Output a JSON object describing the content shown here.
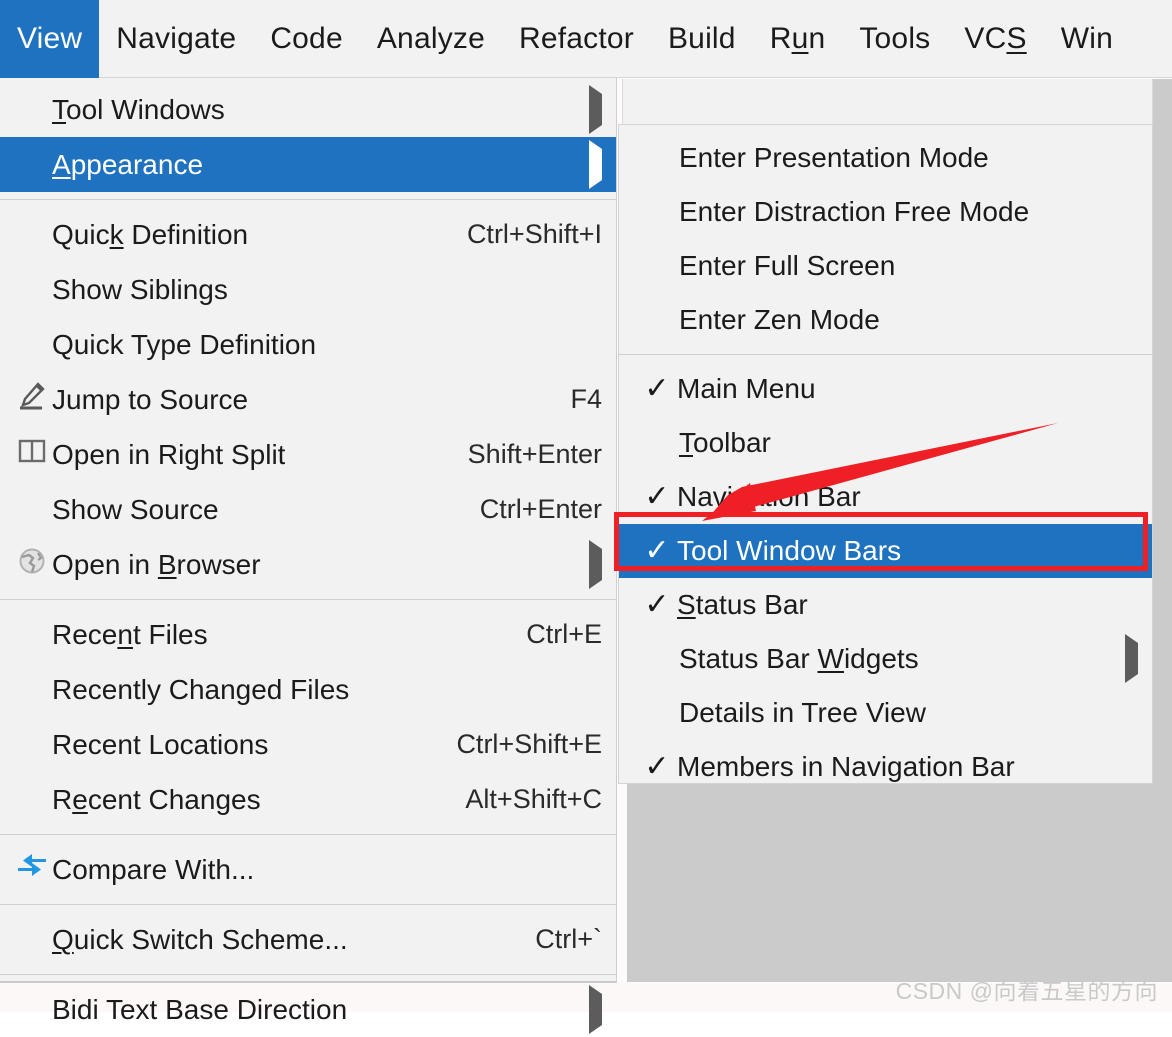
{
  "menubar": {
    "items": [
      {
        "label": "View",
        "mnemonic": "V",
        "active": true
      },
      {
        "label": "Navigate",
        "mnemonic": "N",
        "active": false
      },
      {
        "label": "Code",
        "mnemonic": "C",
        "active": false
      },
      {
        "label": "Analyze",
        "mnemonic": "A",
        "active": false
      },
      {
        "label": "Refactor",
        "mnemonic": "R",
        "active": false
      },
      {
        "label": "Build",
        "mnemonic": "B",
        "active": false
      },
      {
        "label": "Run",
        "mnemonic": "u",
        "active": false
      },
      {
        "label": "Tools",
        "mnemonic": "T",
        "active": false
      },
      {
        "label": "VCS",
        "mnemonic": "S",
        "active": false
      },
      {
        "label": "Win",
        "mnemonic": "W",
        "active": false
      }
    ]
  },
  "view_menu": {
    "items": [
      {
        "label": "Tool Windows",
        "mnemonic_pre": "T",
        "accel": "",
        "icon": "",
        "submenu": true,
        "selected": false,
        "checked": false
      },
      {
        "label": "Appearance",
        "mnemonic_pre": "A",
        "accel": "",
        "icon": "",
        "submenu": true,
        "selected": true,
        "checked": false
      },
      {
        "separator": true
      },
      {
        "label": "Quick Definition",
        "mnemonic_mid": "k",
        "accel": "Ctrl+Shift+I",
        "icon": "",
        "submenu": false,
        "selected": false,
        "checked": false
      },
      {
        "label": "Show Siblings",
        "accel": "",
        "icon": "",
        "submenu": false,
        "selected": false,
        "checked": false
      },
      {
        "label": "Quick Type Definition",
        "accel": "",
        "icon": "",
        "submenu": false,
        "selected": false,
        "checked": false
      },
      {
        "label": "Jump to Source",
        "accel": "F4",
        "icon": "pencil-icon",
        "submenu": false,
        "selected": false,
        "checked": false
      },
      {
        "label": "Open in Right Split",
        "accel": "Shift+Enter",
        "icon": "split-pane-icon",
        "submenu": false,
        "selected": false,
        "checked": false
      },
      {
        "label": "Show Source",
        "accel": "Ctrl+Enter",
        "icon": "",
        "submenu": false,
        "selected": false,
        "checked": false
      },
      {
        "label": "Open in Browser",
        "mnemonic_mid": "B",
        "accel": "",
        "icon": "globe-icon",
        "submenu": true,
        "selected": false,
        "checked": false
      },
      {
        "separator": true
      },
      {
        "label": "Recent Files",
        "mnemonic_mid": "n",
        "accel": "Ctrl+E",
        "icon": "",
        "submenu": false,
        "selected": false,
        "checked": false
      },
      {
        "label": "Recently Changed Files",
        "accel": "",
        "icon": "",
        "submenu": false,
        "selected": false,
        "checked": false
      },
      {
        "label": "Recent Locations",
        "accel": "Ctrl+Shift+E",
        "icon": "",
        "submenu": false,
        "selected": false,
        "checked": false
      },
      {
        "label": "Recent Changes",
        "mnemonic_mid": "e",
        "accel": "Alt+Shift+C",
        "icon": "",
        "submenu": false,
        "selected": false,
        "checked": false
      },
      {
        "separator": true
      },
      {
        "label": "Compare With...",
        "accel": "",
        "icon": "compare-icon",
        "submenu": false,
        "selected": false,
        "checked": false
      },
      {
        "separator": true
      },
      {
        "label": "Quick Switch Scheme...",
        "mnemonic_pre": "Q",
        "accel": "Ctrl+`",
        "icon": "",
        "submenu": false,
        "selected": false,
        "checked": false
      },
      {
        "separator": true
      },
      {
        "label": "Bidi Text Base Direction",
        "accel": "",
        "icon": "",
        "submenu": true,
        "selected": false,
        "checked": false
      }
    ]
  },
  "appearance_submenu": {
    "items": [
      {
        "label": "Enter Presentation Mode",
        "checked": false,
        "submenu": false,
        "selected": false
      },
      {
        "label": "Enter Distraction Free Mode",
        "checked": false,
        "submenu": false,
        "selected": false
      },
      {
        "label": "Enter Full Screen",
        "checked": false,
        "submenu": false,
        "selected": false
      },
      {
        "label": "Enter Zen Mode",
        "checked": false,
        "submenu": false,
        "selected": false
      },
      {
        "separator": true
      },
      {
        "label": "Main Menu",
        "checked": true,
        "submenu": false,
        "selected": false
      },
      {
        "label": "Toolbar",
        "mnemonic_pre": "T",
        "checked": false,
        "submenu": false,
        "selected": false
      },
      {
        "label": "Navigation Bar",
        "checked": true,
        "submenu": false,
        "selected": false
      },
      {
        "label": "Tool Window Bars",
        "checked": true,
        "submenu": false,
        "selected": true
      },
      {
        "label": "Status Bar",
        "mnemonic_pre": "S",
        "checked": true,
        "submenu": false,
        "selected": false
      },
      {
        "label": "Status Bar Widgets",
        "mnemonic_mid": "W",
        "checked": false,
        "submenu": true,
        "selected": false
      },
      {
        "label": "Details in Tree View",
        "checked": false,
        "submenu": false,
        "selected": false
      },
      {
        "label": "Members in Navigation Bar",
        "checked": true,
        "submenu": false,
        "selected": false
      }
    ]
  },
  "annotation": {
    "highlight_color": "#ef1f26",
    "arrow_color": "#ee2026",
    "highlighted_item": "Tool Window Bars"
  },
  "theme": {
    "selection_blue": "#1f72c0",
    "menu_background": "#f2f2f2",
    "panel_grey": "#cbcbcb",
    "text_color": "#1b1b1b"
  },
  "watermark": {
    "text": "CSDN @向着五星的方向"
  },
  "icons": {
    "check": "✓",
    "submenu_arrow": "▶"
  }
}
